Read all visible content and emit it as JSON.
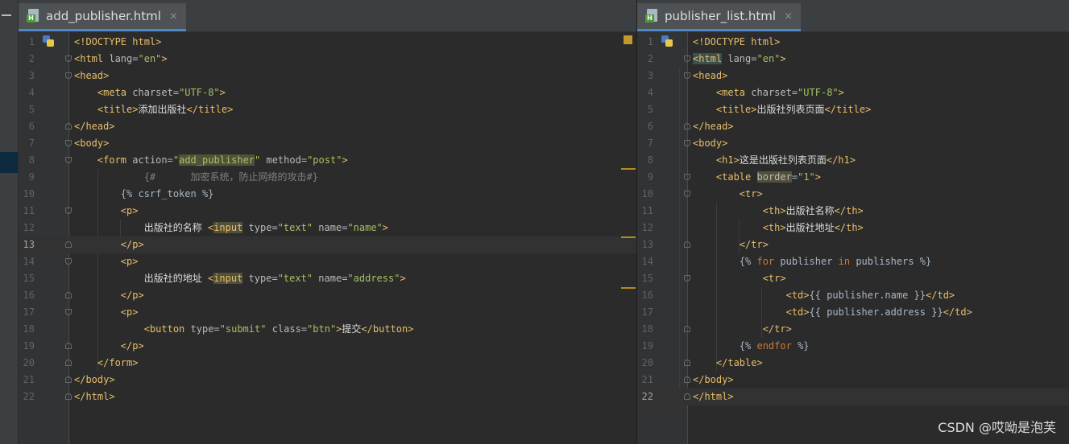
{
  "left_editor": {
    "tab": {
      "icon": "html-file-icon",
      "label": "add_publisher.html",
      "close": "×"
    },
    "lines": [
      {
        "n": "1",
        "code": "<!DOCTYPE html>"
      },
      {
        "n": "2",
        "code": "<html lang=\"en\">"
      },
      {
        "n": "3",
        "code": "<head>"
      },
      {
        "n": "4",
        "code": "    <meta charset=\"UTF-8\">"
      },
      {
        "n": "5",
        "code": "    <title>添加出版社</title>"
      },
      {
        "n": "6",
        "code": "</head>"
      },
      {
        "n": "7",
        "code": "<body>"
      },
      {
        "n": "8",
        "code": "    <form action=\"add_publisher\" method=\"post\">"
      },
      {
        "n": "9",
        "code": "            {#      加密系统，防止网络的攻击#}"
      },
      {
        "n": "10",
        "code": "        {% csrf_token %}"
      },
      {
        "n": "11",
        "code": "        <p>"
      },
      {
        "n": "12",
        "code": "            出版社的名称 <input type=\"text\" name=\"name\">"
      },
      {
        "n": "13",
        "code": "        </p>"
      },
      {
        "n": "14",
        "code": "        <p>"
      },
      {
        "n": "15",
        "code": "            出版社的地址 <input type=\"text\" name=\"address\">"
      },
      {
        "n": "16",
        "code": "        </p>"
      },
      {
        "n": "17",
        "code": "        <p>"
      },
      {
        "n": "18",
        "code": "            <button type=\"submit\" class=\"btn\">提交</button>"
      },
      {
        "n": "19",
        "code": "        </p>"
      },
      {
        "n": "20",
        "code": "    </form>"
      },
      {
        "n": "21",
        "code": "</body>"
      },
      {
        "n": "22",
        "code": "</html>"
      }
    ]
  },
  "right_editor": {
    "tab": {
      "icon": "html-file-icon",
      "label": "publisher_list.html",
      "close": "×"
    },
    "lines": [
      {
        "n": "1",
        "code": "<!DOCTYPE html>"
      },
      {
        "n": "2",
        "code": "<html lang=\"en\">"
      },
      {
        "n": "3",
        "code": "<head>"
      },
      {
        "n": "4",
        "code": "    <meta charset=\"UTF-8\">"
      },
      {
        "n": "5",
        "code": "    <title>出版社列表页面</title>"
      },
      {
        "n": "6",
        "code": "</head>"
      },
      {
        "n": "7",
        "code": "<body>"
      },
      {
        "n": "8",
        "code": "    <h1>这是出版社列表页面</h1>"
      },
      {
        "n": "9",
        "code": "    <table border=\"1\">"
      },
      {
        "n": "10",
        "code": "        <tr>"
      },
      {
        "n": "11",
        "code": "            <th>出版社名称</th>"
      },
      {
        "n": "12",
        "code": "            <th>出版社地址</th>"
      },
      {
        "n": "13",
        "code": "        </tr>"
      },
      {
        "n": "14",
        "code": "        {% for publisher in publishers %}"
      },
      {
        "n": "15",
        "code": "            <tr>"
      },
      {
        "n": "16",
        "code": "                <td>{{ publisher.name }}</td>"
      },
      {
        "n": "17",
        "code": "                <td>{{ publisher.address }}</td>"
      },
      {
        "n": "18",
        "code": "            </tr>"
      },
      {
        "n": "19",
        "code": "        {% endfor %}"
      },
      {
        "n": "20",
        "code": "    </table>"
      },
      {
        "n": "21",
        "code": "</body>"
      },
      {
        "n": "22",
        "code": "</html>"
      }
    ]
  },
  "watermark": "CSDN @哎呦是泡芙",
  "colors": {
    "background": "#2b2b2b",
    "tag": "#e8bf6a",
    "string": "#a5c261",
    "comment": "#808080",
    "keyword": "#cc7832"
  }
}
